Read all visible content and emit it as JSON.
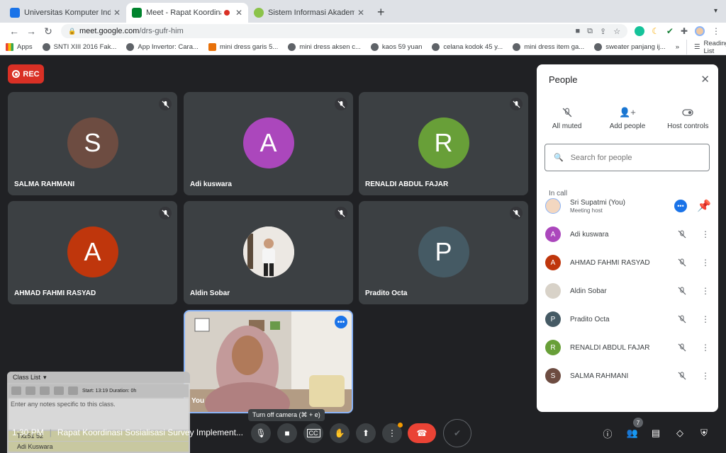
{
  "browser": {
    "tabs": [
      {
        "title": "Universitas Komputer Indonesi",
        "favicon_color": "#1a73e8"
      },
      {
        "title": "Meet - Rapat Koordinasi So",
        "favicon_color": "#00832d",
        "recording": true
      },
      {
        "title": "Sistem Informasi Akademik - U",
        "favicon_color": "#8bc34a"
      }
    ],
    "new_tab": "+",
    "url_host": "meet.google.com",
    "url_path": "/drs-gufr-him",
    "bookmarks": [
      {
        "label": "Apps"
      },
      {
        "label": "SNTI XIII 2016 Fak..."
      },
      {
        "label": "App Invertor: Cara..."
      },
      {
        "label": "mini dress garis 5..."
      },
      {
        "label": "mini dress aksen c..."
      },
      {
        "label": "kaos 59 yuan"
      },
      {
        "label": "celana kodok 45 y..."
      },
      {
        "label": "mini dress item ga..."
      },
      {
        "label": "sweater panjang ij..."
      }
    ],
    "bookmarks_more": "»",
    "reading_list": "Reading List"
  },
  "meet": {
    "rec_label": "REC",
    "tiles": [
      {
        "name": "SALMA RAHMANI",
        "initial": "S",
        "color": "#6d4c41"
      },
      {
        "name": "Adi kuswara",
        "initial": "A",
        "color": "#ab47bc"
      },
      {
        "name": "RENALDI ABDUL FAJAR",
        "initial": "R",
        "color": "#689f38"
      },
      {
        "name": "AHMAD FAHMI RASYAD",
        "initial": "A",
        "color": "#bf360c"
      },
      {
        "name": "Aldin Sobar",
        "initial": ""
      },
      {
        "name": "Pradito Octa",
        "initial": "P",
        "color": "#455a64"
      }
    ],
    "self_tile_name": "You",
    "tooltip": "Turn off camera (⌘ + e)",
    "time": "1:30 PM",
    "meeting_title": "Rapat Koordinasi Sosialisasi Survey Implement...",
    "people_count": "7"
  },
  "classlist": {
    "title": "Class List",
    "bar_text": "Start: 13:19  Duration: 0h",
    "notes_placeholder": "Enter any notes specific to this class.",
    "rows": [
      "Txz51 52",
      "Adi Kuswara"
    ]
  },
  "people_panel": {
    "title": "People",
    "actions": [
      "All muted",
      "Add people",
      "Host controls"
    ],
    "search_placeholder": "Search for people",
    "section_label": "In call",
    "host": {
      "name": "Sri Supatmi (You)",
      "role": "Meeting host"
    },
    "participants": [
      {
        "name": "Adi kuswara",
        "initial": "A",
        "color": "#ab47bc"
      },
      {
        "name": "AHMAD FAHMI RASYAD",
        "initial": "A",
        "color": "#bf360c"
      },
      {
        "name": "Aldin Sobar",
        "initial": ""
      },
      {
        "name": "Pradito Octa",
        "initial": "P",
        "color": "#455a64"
      },
      {
        "name": "RENALDI ABDUL FAJAR",
        "initial": "R",
        "color": "#689f38"
      },
      {
        "name": "SALMA RAHMANI",
        "initial": "S",
        "color": "#6d4c41"
      }
    ]
  }
}
